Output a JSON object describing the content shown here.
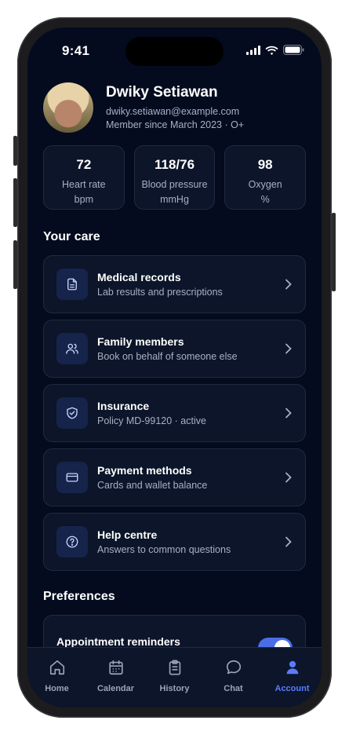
{
  "status": {
    "time": "9:41"
  },
  "profile": {
    "name": "Dwiky Setiawan",
    "email": "dwiky.setiawan@example.com",
    "member": "Member since March 2023 · O+"
  },
  "stats": [
    {
      "value": "72",
      "label": "Heart rate",
      "unit": "bpm"
    },
    {
      "value": "118/76",
      "label": "Blood pressure",
      "unit": "mmHg"
    },
    {
      "value": "98",
      "label": "Oxygen",
      "unit": "%"
    }
  ],
  "care": {
    "title": "Your care",
    "items": [
      {
        "title": "Medical records",
        "subtitle": "Lab results and prescriptions",
        "icon": "document-icon"
      },
      {
        "title": "Family members",
        "subtitle": "Book on behalf of someone else",
        "icon": "users-icon"
      },
      {
        "title": "Insurance",
        "subtitle": "Policy MD-99120 · active",
        "icon": "shield-icon"
      },
      {
        "title": "Payment methods",
        "subtitle": "Cards and wallet balance",
        "icon": "card-icon"
      },
      {
        "title": "Help centre",
        "subtitle": "Answers to common questions",
        "icon": "help-icon"
      }
    ]
  },
  "preferences": {
    "title": "Preferences",
    "reminders_label": "Appointment reminders",
    "reminders_on": true
  },
  "tabs": [
    {
      "label": "Home",
      "icon": "home-icon"
    },
    {
      "label": "Calendar",
      "icon": "calendar-icon"
    },
    {
      "label": "History",
      "icon": "clipboard-icon"
    },
    {
      "label": "Chat",
      "icon": "chat-icon"
    },
    {
      "label": "Account",
      "icon": "user-icon",
      "active": true
    }
  ],
  "colors": {
    "background": "#040b1e",
    "card": "#0c1529",
    "accent": "#5b7bff",
    "icon_tile": "#16234a"
  }
}
